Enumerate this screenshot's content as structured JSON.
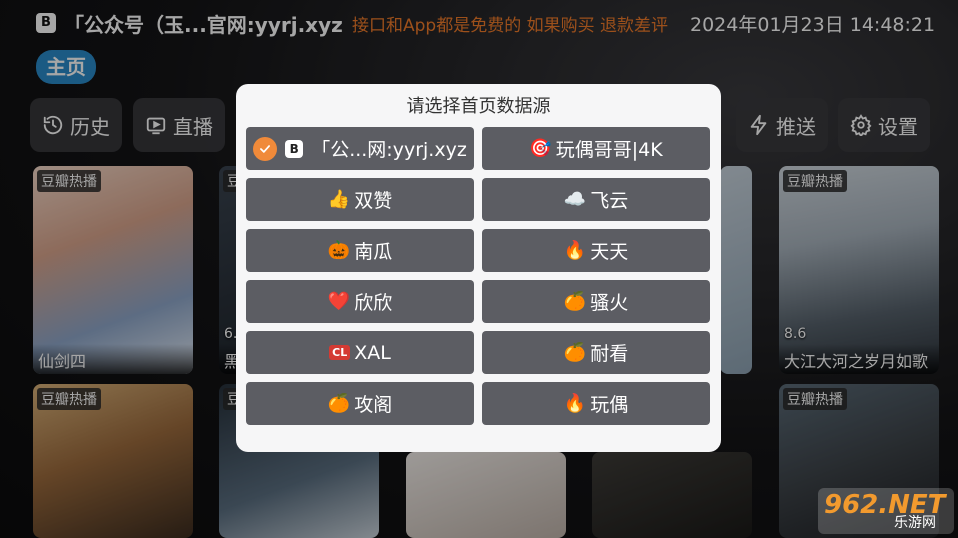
{
  "header": {
    "logo_letter": "B",
    "site_title": "「公众号（玉...官网:yyrj.xyz",
    "notice": "接口和App都是免费的 如果购买 退款差评",
    "datetime": "2024年01月23日 14:48:21"
  },
  "home_tab": "主页",
  "nav": {
    "history": "历史",
    "live": "直播",
    "push": "推送",
    "settings": "设置"
  },
  "cards": [
    {
      "tag": "豆瓣热播",
      "title": "仙剑四",
      "score": ""
    },
    {
      "tag": "豆",
      "title": "黑",
      "score": "6."
    },
    {
      "tag": "豆瓣热播",
      "title": "大江大河之岁月如歌",
      "score": "8.6"
    },
    {
      "tag": "豆瓣热播",
      "title": "",
      "score": ""
    },
    {
      "tag": "豆",
      "title": "",
      "score": ""
    },
    {
      "tag": "豆瓣热播",
      "title": "",
      "score": ""
    }
  ],
  "dialog": {
    "title": "请选择首页数据源",
    "options": [
      {
        "emoji": "",
        "label": "「公...网:yyrj.xyz",
        "selected": true
      },
      {
        "emoji": "🎯",
        "label": "玩偶哥哥|4K",
        "selected": false
      },
      {
        "emoji": "👍",
        "label": "双赞",
        "selected": false
      },
      {
        "emoji": "☁️",
        "label": "飞云",
        "selected": false
      },
      {
        "emoji": "🎃",
        "label": "南瓜",
        "selected": false
      },
      {
        "emoji": "🔥",
        "label": "天天",
        "selected": false
      },
      {
        "emoji": "❤️",
        "label": "欣欣",
        "selected": false
      },
      {
        "emoji": "🍊",
        "label": "骚火",
        "selected": false
      },
      {
        "emoji": "CL",
        "label": "XAL",
        "selected": false
      },
      {
        "emoji": "🍊",
        "label": "耐看",
        "selected": false
      },
      {
        "emoji": "🍊",
        "label": "攻阁",
        "selected": false
      },
      {
        "emoji": "🔥",
        "label": "玩偶",
        "selected": false
      }
    ]
  },
  "watermark": {
    "brand": "962.NET",
    "sub": "乐游网"
  },
  "colors": {
    "accent_blue": "#2a8bc9",
    "notice_orange": "#f07b2a",
    "option_bg": "#5c5d63",
    "check_orange": "#f08a3a",
    "dialog_bg": "#f6f6f7"
  },
  "icons": {
    "history": "history-clock-icon",
    "live": "tv-play-icon",
    "push": "lightning-icon",
    "settings": "gear-icon",
    "selected": "check-circle-icon"
  }
}
